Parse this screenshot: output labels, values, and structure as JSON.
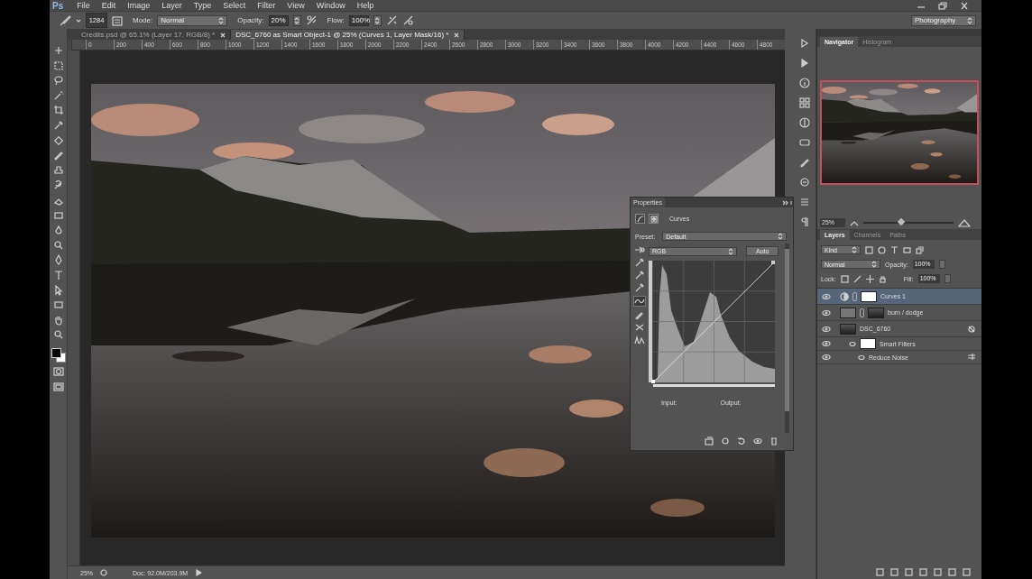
{
  "app": {
    "logo": "Ps",
    "menu": [
      "File",
      "Edit",
      "Image",
      "Layer",
      "Type",
      "Select",
      "Filter",
      "View",
      "Window",
      "Help"
    ]
  },
  "options": {
    "brush_size": "1284",
    "mode_label": "Mode:",
    "mode": "Normal",
    "opacity_label": "Opacity:",
    "opacity": "20%",
    "flow_label": "Flow:",
    "flow": "100%",
    "workspace": "Photography"
  },
  "document_tabs": [
    {
      "label": "Credits.psd @ 65.1% (Layer 17, RGB/8) *",
      "selected": false
    },
    {
      "label": "DSC_6760 as Smart Object-1 @ 25% (Curves 1, Layer Mask/16) *",
      "selected": true
    }
  ],
  "ruler": {
    "labels": [
      "0",
      "200",
      "400",
      "600",
      "800",
      "1000",
      "1200",
      "1400",
      "1600",
      "1800",
      "2000",
      "2200",
      "2400",
      "2600",
      "2800",
      "3000",
      "3200",
      "3400",
      "3600",
      "3800",
      "4000",
      "4200",
      "4400",
      "4600",
      "4800"
    ]
  },
  "properties": {
    "title": "Properties",
    "adjustment": "Curves",
    "preset_label": "Preset:",
    "preset": "Default",
    "channel": "RGB",
    "auto_button": "Auto",
    "input_label": "Input:",
    "output_label": "Output:"
  },
  "navigator": {
    "tabs": [
      {
        "label": "Navigator",
        "selected": true
      },
      {
        "label": "Histogram",
        "selected": false
      }
    ],
    "zoom": "25%",
    "zoom_slider": {
      "level": 0.42
    }
  },
  "layers_panel": {
    "tabs": [
      {
        "label": "Layers",
        "selected": true
      },
      {
        "label": "Channels",
        "selected": false
      },
      {
        "label": "Paths",
        "selected": false
      }
    ],
    "filter": "Kind",
    "blend_mode": "Normal",
    "opacity_label": "Opacity:",
    "opacity": "100%",
    "lock_label": "Lock:",
    "fill_label": "Fill:",
    "fill": "100%",
    "layers": [
      {
        "kind": "adjustment",
        "name": "Curves 1",
        "selected": true
      },
      {
        "kind": "pixel",
        "name": "burn / dodge",
        "selected": false
      },
      {
        "kind": "smart-object",
        "name": "DSC_6760",
        "selected": false,
        "children": [
          {
            "kind": "smart-filters",
            "name": "Smart Filters",
            "selected": false,
            "children": [
              {
                "kind": "filter",
                "name": "Reduce Noise",
                "selected": false
              }
            ]
          }
        ]
      }
    ]
  },
  "status_bar": {
    "zoom": "25%",
    "doc_size": "Doc: 92.0M/203.9M"
  }
}
